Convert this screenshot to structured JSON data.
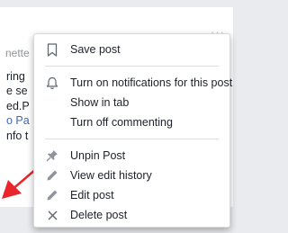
{
  "post": {
    "options_glyph": "···",
    "author_fragment": "nette",
    "body_lines": [
      {
        "text": "ring",
        "link": false
      },
      {
        "text": "e se",
        "link": false
      },
      {
        "text": "ed.P",
        "link": false
      },
      {
        "text": "o Pa",
        "link": true
      },
      {
        "text": "nfo t",
        "link": false
      }
    ]
  },
  "menu": {
    "save_post": "Save post",
    "turn_on_notifications": "Turn on notifications for this post",
    "show_in_tab": "Show in tab",
    "turn_off_commenting": "Turn off commenting",
    "unpin_post": "Unpin Post",
    "view_edit_history": "View edit history",
    "edit_post": "Edit post",
    "delete_post": "Delete post"
  },
  "colors": {
    "arrow": "#e8262c",
    "link": "#4267b2",
    "icon": "#90949c"
  }
}
